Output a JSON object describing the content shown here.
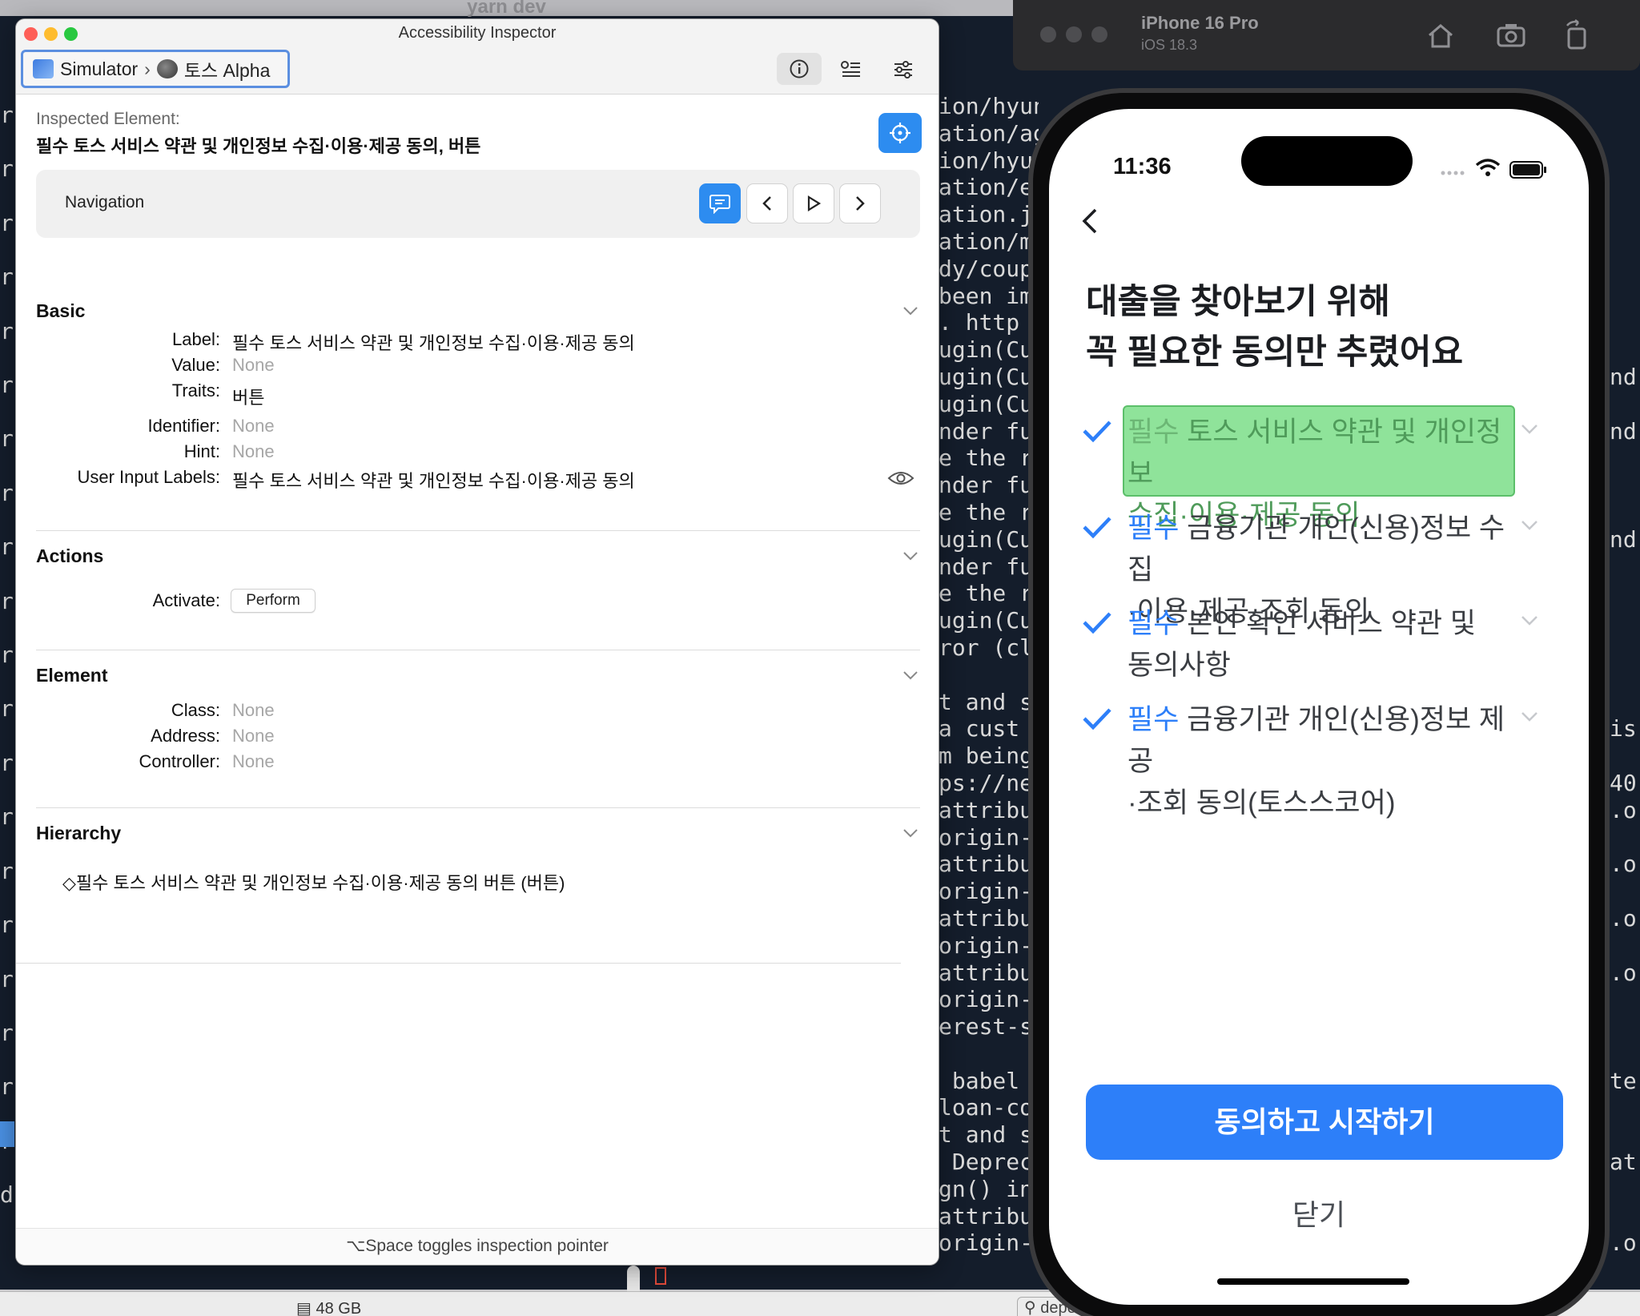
{
  "terminal": {
    "window_title": "yarn dev",
    "left_strip": [
      "r",
      "r",
      "r",
      "r",
      "r",
      "r",
      "r",
      "r",
      "r",
      "r",
      "r",
      "r",
      "r",
      "r",
      "r",
      "r",
      "r",
      "r",
      "r",
      "r",
      "d"
    ],
    "middle_lines": [
      "ion/hyundai",
      "ation/agr",
      "ion/hyur",
      "ation/e",
      "ation.j",
      "ation/m",
      "dy/coup",
      "been im",
      ". http",
      "ugin(Cu",
      "ugin(Cu",
      "ugin(Cu",
      "nder fu",
      "e the r",
      "nder fu",
      "e the r",
      "ugin(Cu",
      "nder fu",
      "e the r",
      "ugin(Cu",
      "ror (cl",
      "",
      "t and s",
      "a cust",
      "m being",
      "ps://ne",
      "attribu",
      "origin-",
      "attribu",
      "origin-",
      "attribu",
      "origin-",
      "attribu",
      "origin-",
      "erest-s",
      "",
      " babel",
      "loan-co",
      "t and s",
      " Deprec",
      "gn() in",
      "attribu",
      "origin-d"
    ],
    "right_lines": [
      "",
      "",
      "",
      "",
      "",
      "",
      "",
      "",
      "",
      "",
      "nd",
      "",
      "nd",
      "",
      "",
      "",
      "nd",
      "",
      "",
      "",
      "",
      "",
      "",
      "is",
      "",
      "40",
      ".o",
      "",
      ".o",
      "",
      ".o",
      "",
      ".o",
      "",
      "",
      "",
      "te",
      "",
      "",
      "at",
      "",
      "",
      ".o"
    ],
    "status_memory": "48 GB",
    "status_search": "dependen"
  },
  "simulator": {
    "device_name": "iPhone 16 Pro",
    "os_version": "iOS 18.3"
  },
  "inspector": {
    "window_title": "Accessibility Inspector",
    "target": {
      "host": "Simulator",
      "app": "토스 Alpha"
    },
    "inspected_caption": "Inspected Element:",
    "inspected_value": "필수 토스 서비스 약관 및 개인정보 수집·이용·제공 동의, 버튼",
    "navigation_label": "Navigation",
    "sections": {
      "basic": {
        "title": "Basic",
        "label_key": "Label:",
        "label_val": "필수 토스 서비스 약관 및 개인정보 수집·이용·제공 동의",
        "value_key": "Value:",
        "value_val": "None",
        "traits_key": "Traits:",
        "traits_val": "버튼",
        "identifier_key": "Identifier:",
        "identifier_val": "None",
        "hint_key": "Hint:",
        "hint_val": "None",
        "user_input_key": "User Input Labels:",
        "user_input_val": "필수 토스 서비스 약관 및 개인정보 수집·이용·제공 동의"
      },
      "actions": {
        "title": "Actions",
        "activate_key": "Activate:",
        "perform_label": "Perform"
      },
      "element": {
        "title": "Element",
        "class_key": "Class:",
        "class_val": "None",
        "address_key": "Address:",
        "address_val": "None",
        "controller_key": "Controller:",
        "controller_val": "None"
      },
      "hierarchy": {
        "title": "Hierarchy",
        "item": "◇필수 토스 서비스 약관 및 개인정보 수집·이용·제공 동의 버튼 (버튼)"
      }
    },
    "bottom_hint": "⌥Space toggles inspection pointer"
  },
  "phone": {
    "time": "11:36",
    "heading_line1": "대출을 찾아보기 위해",
    "heading_line2": "꼭 필요한 동의만 추렸어요",
    "consents": [
      {
        "tag": "필수",
        "line1": "토스 서비스 약관 및 개인정보",
        "line2": "수집·이용·제공 동의",
        "highlighted": true
      },
      {
        "tag": "필수",
        "line1": "금융기관 개인(신용)정보 수집",
        "line2": "·이용·제공·조회 동의",
        "highlighted": false
      },
      {
        "tag": "필수",
        "line1": "본인 확인 서비스 약관 및",
        "line2": "동의사항",
        "highlighted": false
      },
      {
        "tag": "필수",
        "line1": "금융기관 개인(신용)정보 제공",
        "line2": "·조회 동의(토스스코어)",
        "highlighted": false
      }
    ],
    "primary_button": "동의하고 시작하기",
    "secondary_link": "닫기"
  },
  "colors": {
    "accent_blue": "#2d7ff9",
    "inspector_blue": "#2d8cf0",
    "highlight_green": "#8fe39a",
    "terminal_bg": "#141d2b"
  }
}
